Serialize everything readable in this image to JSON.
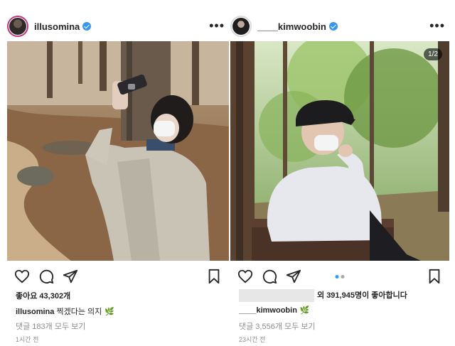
{
  "left_post": {
    "username": "illusomina",
    "more_label": "•••",
    "likes_text": "좋아요 43,302개",
    "caption_user": "illusomina",
    "caption_text": "찍겠다는 의지",
    "caption_emoji": "🌿",
    "comments_link": "댓글 183개 모두 보기",
    "time_ago": "1시간 전"
  },
  "right_post": {
    "username": "____kimwoobin",
    "more_label": "•••",
    "counter": "1/2",
    "likes_suffix_1": "외 ",
    "likes_count": "391,945명이",
    "likes_suffix_2": " 좋아합니다",
    "caption_user": "____kimwoobin",
    "caption_emoji": "🌿",
    "comments_link": "댓글 3,556개 모두 보기",
    "time_ago": "23시간 전"
  },
  "icons": [
    "heart-icon",
    "comment-icon",
    "share-icon",
    "bookmark-icon",
    "verified-badge-icon",
    "more-options-icon"
  ],
  "colors": {
    "verified": "#3897f0",
    "story_ring": "#c13584",
    "text_primary": "#262626",
    "text_secondary": "#8e8e8e",
    "carousel_active": "#3897f0"
  }
}
